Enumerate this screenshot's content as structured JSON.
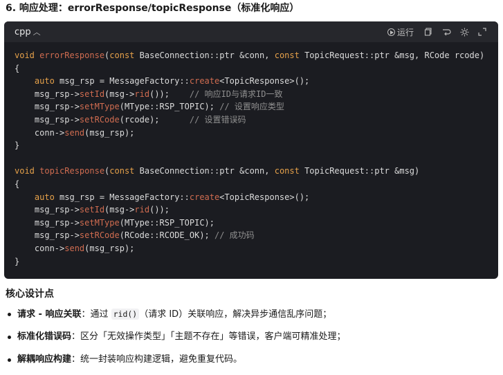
{
  "section_title": "6. 响应处理：errorResponse/topicResponse（标准化响应）",
  "code_block": {
    "language": "cpp",
    "run_label": "运行",
    "icons": [
      "play-circle-icon",
      "copy-icon",
      "wrap-icon",
      "theme-icon",
      "collapse-icon"
    ],
    "lines": [
      [
        [
          "kw",
          "void "
        ],
        [
          "fn",
          "errorResponse"
        ],
        [
          "tx",
          "("
        ],
        [
          "kw",
          "const "
        ],
        [
          "tx",
          "BaseConnection::ptr &conn, "
        ],
        [
          "kw",
          "const "
        ],
        [
          "tx",
          "TopicRequest::ptr &msg, RCode rcode)"
        ]
      ],
      [
        [
          "tx",
          "{"
        ]
      ],
      [
        [
          "tx",
          "    "
        ],
        [
          "kw",
          "auto "
        ],
        [
          "tx",
          "msg_rsp = MessageFactory::"
        ],
        [
          "fn",
          "create"
        ],
        [
          "tx",
          "<TopicResponse>();"
        ]
      ],
      [
        [
          "tx",
          "    msg_rsp->"
        ],
        [
          "fn",
          "setId"
        ],
        [
          "tx",
          "(msg->"
        ],
        [
          "fn",
          "rid"
        ],
        [
          "tx",
          "());    "
        ],
        [
          "cm",
          "// 响应ID与请求ID一致"
        ]
      ],
      [
        [
          "tx",
          "    msg_rsp->"
        ],
        [
          "fn",
          "setMType"
        ],
        [
          "tx",
          "(MType::RSP_TOPIC); "
        ],
        [
          "cm",
          "// 设置响应类型"
        ]
      ],
      [
        [
          "tx",
          "    msg_rsp->"
        ],
        [
          "fn",
          "setRCode"
        ],
        [
          "tx",
          "(rcode);      "
        ],
        [
          "cm",
          "// 设置错误码"
        ]
      ],
      [
        [
          "tx",
          "    conn->"
        ],
        [
          "fn",
          "send"
        ],
        [
          "tx",
          "(msg_rsp);"
        ]
      ],
      [
        [
          "tx",
          "}"
        ]
      ],
      [
        [
          "tx",
          ""
        ]
      ],
      [
        [
          "kw",
          "void "
        ],
        [
          "fn",
          "topicResponse"
        ],
        [
          "tx",
          "("
        ],
        [
          "kw",
          "const "
        ],
        [
          "tx",
          "BaseConnection::ptr &conn, "
        ],
        [
          "kw",
          "const "
        ],
        [
          "tx",
          "TopicRequest::ptr &msg)"
        ]
      ],
      [
        [
          "tx",
          "{"
        ]
      ],
      [
        [
          "tx",
          "    "
        ],
        [
          "kw",
          "auto "
        ],
        [
          "tx",
          "msg_rsp = MessageFactory::"
        ],
        [
          "fn",
          "create"
        ],
        [
          "tx",
          "<TopicResponse>();"
        ]
      ],
      [
        [
          "tx",
          "    msg_rsp->"
        ],
        [
          "fn",
          "setId"
        ],
        [
          "tx",
          "(msg->"
        ],
        [
          "fn",
          "rid"
        ],
        [
          "tx",
          "());"
        ]
      ],
      [
        [
          "tx",
          "    msg_rsp->"
        ],
        [
          "fn",
          "setMType"
        ],
        [
          "tx",
          "(MType::RSP_TOPIC);"
        ]
      ],
      [
        [
          "tx",
          "    msg_rsp->"
        ],
        [
          "fn",
          "setRCode"
        ],
        [
          "tx",
          "(RCode::RCODE_OK); "
        ],
        [
          "cm",
          "// 成功码"
        ]
      ],
      [
        [
          "tx",
          "    conn->"
        ],
        [
          "fn",
          "send"
        ],
        [
          "tx",
          "(msg_rsp);"
        ]
      ],
      [
        [
          "tx",
          "}"
        ]
      ]
    ]
  },
  "design_points": {
    "heading": "核心设计点",
    "items": [
      {
        "term": "请求 - 响应关联",
        "parts": [
          "：通过 ",
          "rid()",
          "（请求 ID）关联响应，解决异步通信乱序问题；"
        ]
      },
      {
        "term": "标准化错误码",
        "parts": [
          "：区分「无效操作类型」「主题不存在」等错误，客户端可精准处理；"
        ]
      },
      {
        "term": "解耦响应构建",
        "parts": [
          "：统一封装响应构建逻辑，避免重复代码。"
        ]
      }
    ]
  },
  "colors": {
    "code_bg": "#1b1c21",
    "keyword": "#e6a14a",
    "function": "#d06c50",
    "comment": "#8f8f8f"
  }
}
